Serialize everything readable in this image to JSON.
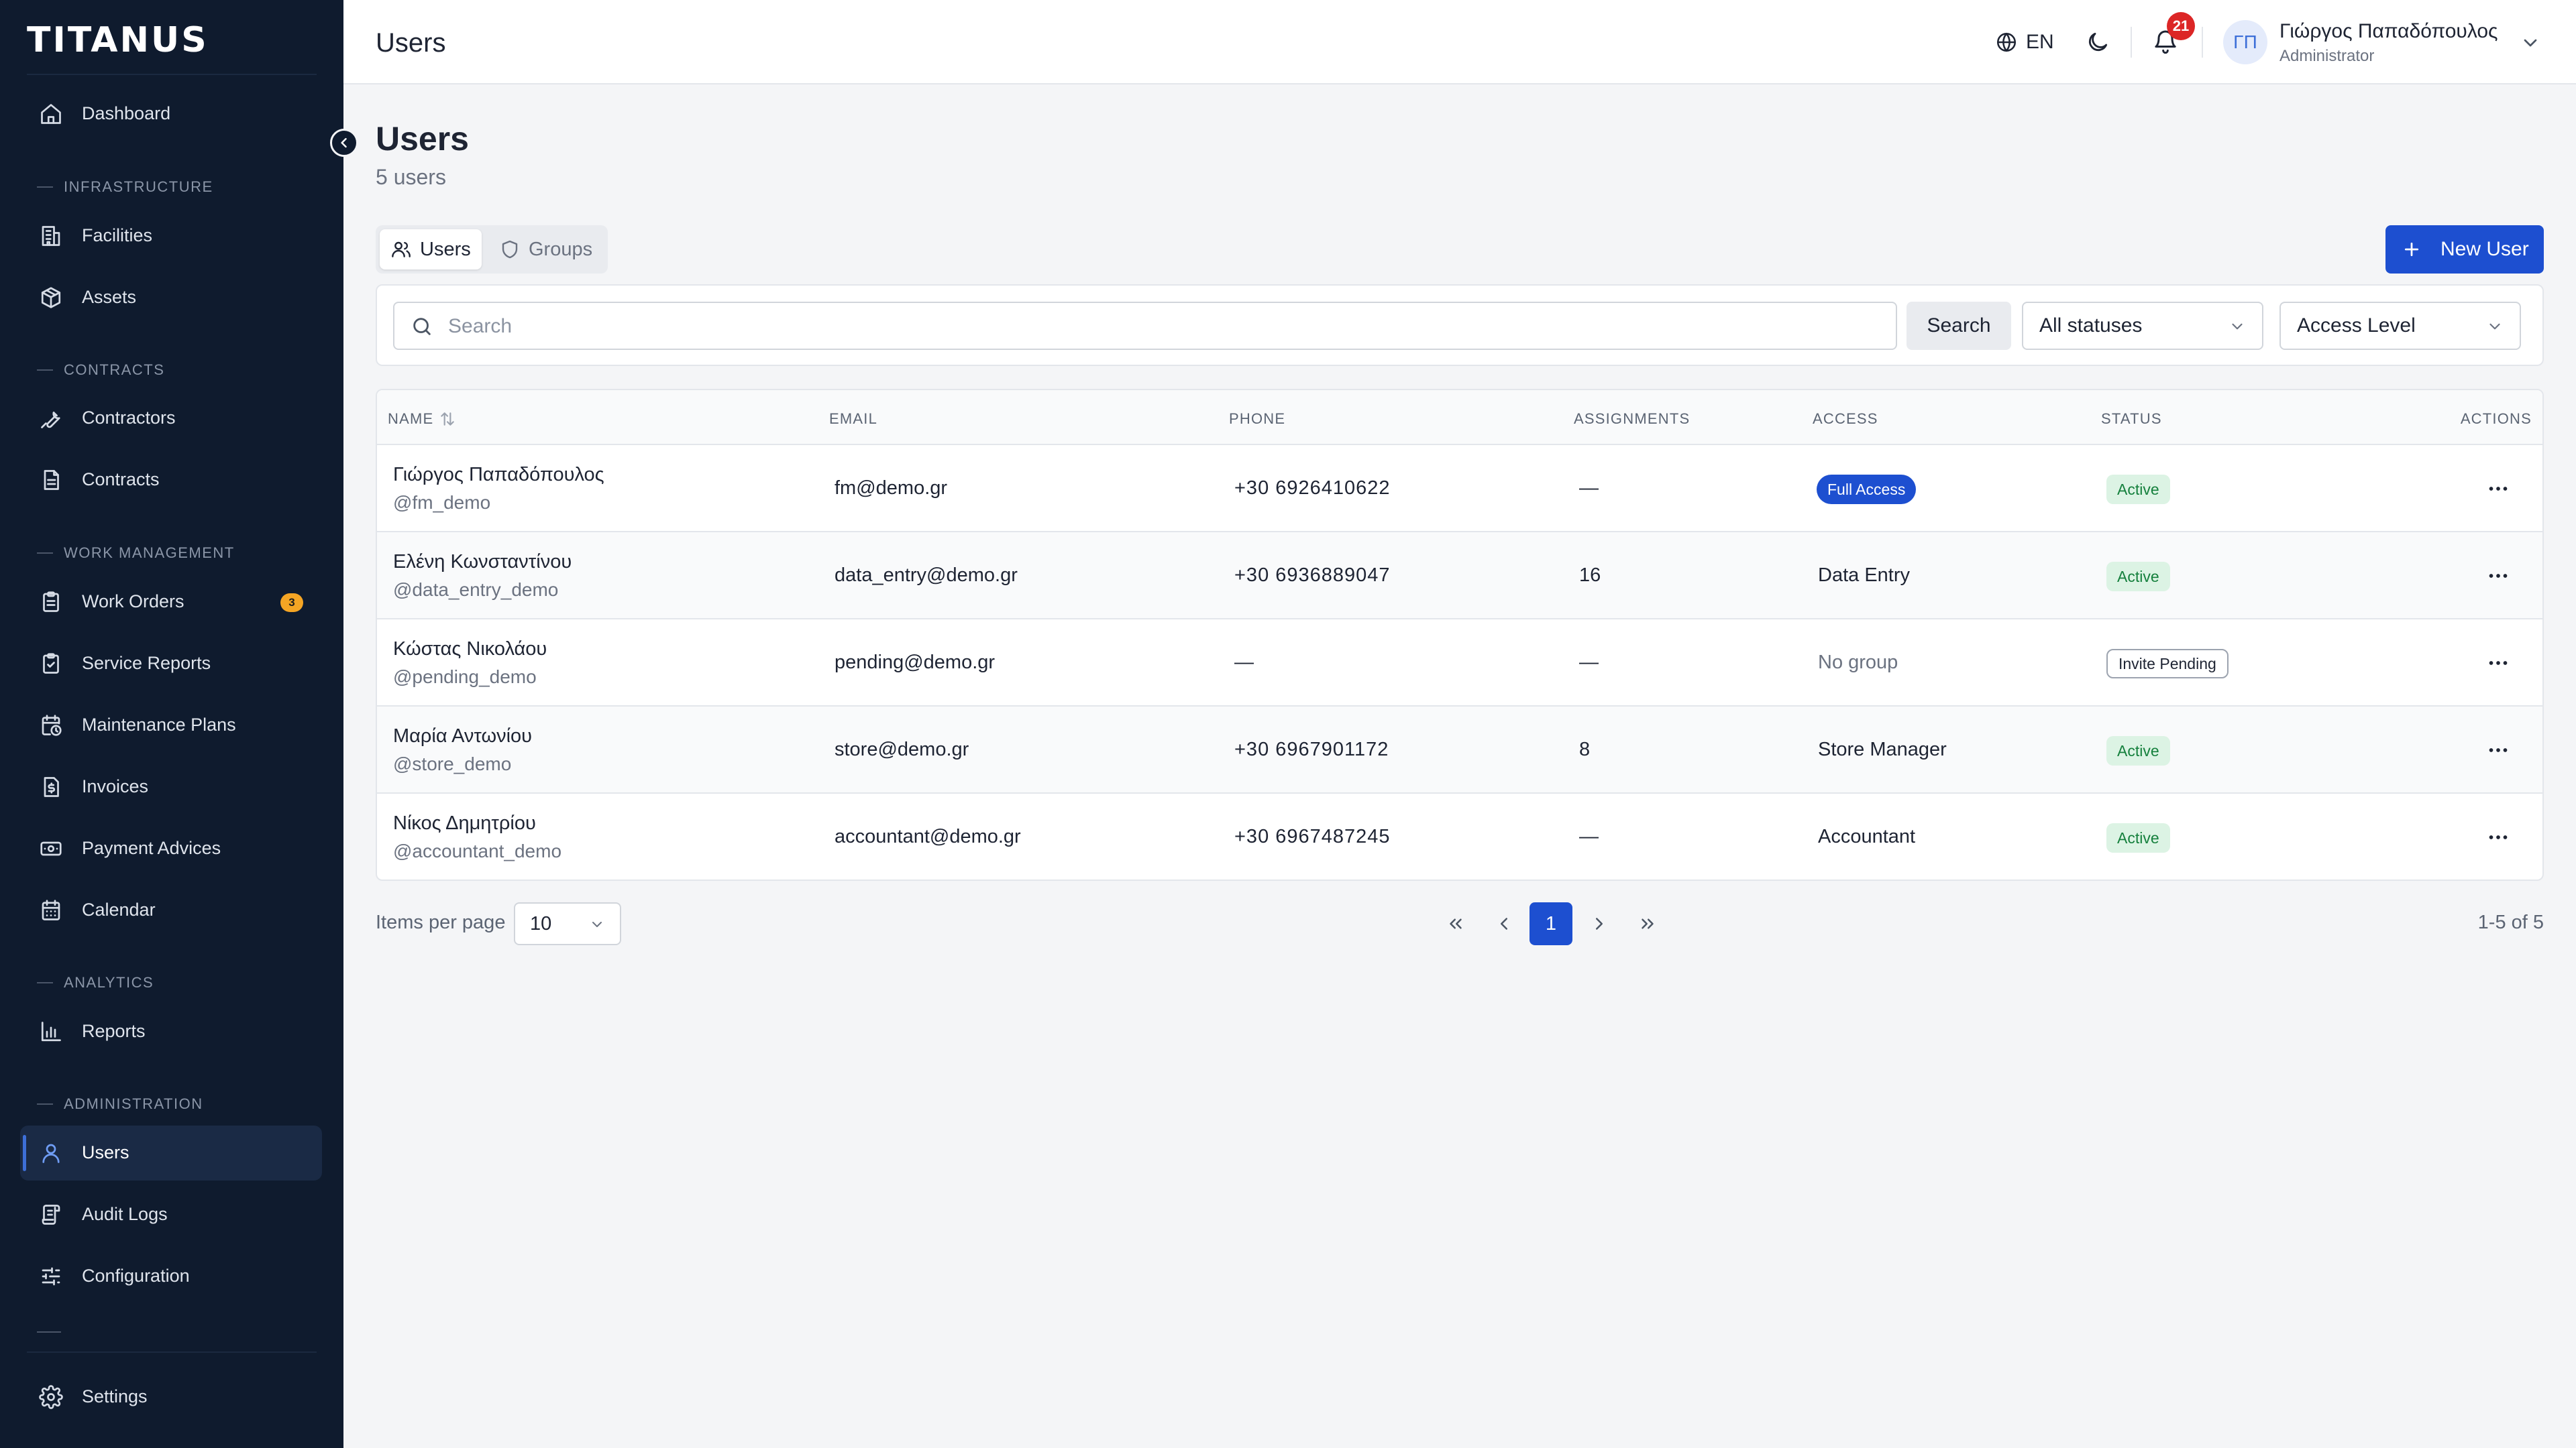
{
  "brand": {
    "logo": "TITANUS"
  },
  "sidebar": {
    "dashboard": "Dashboard",
    "sections": {
      "infrastructure": "INFRASTRUCTURE",
      "contracts": "CONTRACTS",
      "work_management": "WORK MANAGEMENT",
      "analytics": "ANALYTICS",
      "administration": "ADMINISTRATION"
    },
    "items": {
      "facilities": "Facilities",
      "assets": "Assets",
      "contractors": "Contractors",
      "contracts": "Contracts",
      "work_orders": "Work Orders",
      "work_orders_badge": "3",
      "service_reports": "Service Reports",
      "maintenance_plans": "Maintenance Plans",
      "invoices": "Invoices",
      "payment_advices": "Payment Advices",
      "calendar": "Calendar",
      "reports": "Reports",
      "users": "Users",
      "audit_logs": "Audit Logs",
      "configuration": "Configuration",
      "settings": "Settings"
    },
    "active_item": "users"
  },
  "header": {
    "title": "Users",
    "language": "EN",
    "notification_count": "21",
    "user": {
      "initials": "ΓΠ",
      "name": "Γιώργος Παπαδόπουλος",
      "role": "Administrator"
    }
  },
  "page": {
    "title": "Users",
    "subtitle": "5 users",
    "tabs": {
      "users": "Users",
      "groups": "Groups"
    },
    "new_user_label": "New User"
  },
  "filters": {
    "search_placeholder": "Search",
    "search_value": "",
    "search_button": "Search",
    "status_select": "All statuses",
    "access_select": "Access Level"
  },
  "table": {
    "columns": {
      "name": "NAME",
      "email": "EMAIL",
      "phone": "PHONE",
      "assignments": "ASSIGNMENTS",
      "access": "ACCESS",
      "status": "STATUS",
      "actions": "ACTIONS"
    },
    "rows": [
      {
        "name": "Γιώργος Παπαδόπουλος",
        "username": "@fm_demo",
        "email": "fm@demo.gr",
        "phone": "+30 6926410622",
        "assignments": "—",
        "access": "Full Access",
        "access_style": "pill",
        "status": "Active",
        "status_style": "active"
      },
      {
        "name": "Ελένη Κωνσταντίνου",
        "username": "@data_entry_demo",
        "email": "data_entry@demo.gr",
        "phone": "+30 6936889047",
        "assignments": "16",
        "access": "Data Entry",
        "access_style": "text",
        "status": "Active",
        "status_style": "active"
      },
      {
        "name": "Κώστας Νικολάου",
        "username": "@pending_demo",
        "email": "pending@demo.gr",
        "phone": "—",
        "assignments": "—",
        "access": "No group",
        "access_style": "muted",
        "status": "Invite Pending",
        "status_style": "pending"
      },
      {
        "name": "Μαρία Αντωνίου",
        "username": "@store_demo",
        "email": "store@demo.gr",
        "phone": "+30 6967901172",
        "assignments": "8",
        "access": "Store Manager",
        "access_style": "text",
        "status": "Active",
        "status_style": "active"
      },
      {
        "name": "Νίκος Δημητρίου",
        "username": "@accountant_demo",
        "email": "accountant@demo.gr",
        "phone": "+30 6967487245",
        "assignments": "—",
        "access": "Accountant",
        "access_style": "text",
        "status": "Active",
        "status_style": "active"
      }
    ]
  },
  "pagination": {
    "items_per_page_label": "Items per page",
    "items_per_page": "10",
    "current_page": "1",
    "range": "1-5 of 5"
  },
  "colors": {
    "sidebar_bg": "#0f1b2e",
    "accent": "#1d4fd0",
    "active_status_bg": "#dcf3e4",
    "active_status_fg": "#15803d",
    "notification_badge": "#dc2626",
    "work_orders_badge": "#f5a524"
  },
  "icons": {
    "dashboard": "home-icon",
    "facilities": "building-icon",
    "assets": "box-icon",
    "contractors": "wrench-icon",
    "contracts": "document-icon",
    "work_orders": "clipboard-icon",
    "service_reports": "clipboard-check-icon",
    "maintenance_plans": "calendar-clock-icon",
    "invoices": "dollar-document-icon",
    "payment_advices": "banknote-icon",
    "calendar": "calendar-icon",
    "reports": "bar-chart-icon",
    "users": "user-icon",
    "audit_logs": "scroll-icon",
    "configuration": "sliders-icon",
    "settings": "gear-icon"
  }
}
